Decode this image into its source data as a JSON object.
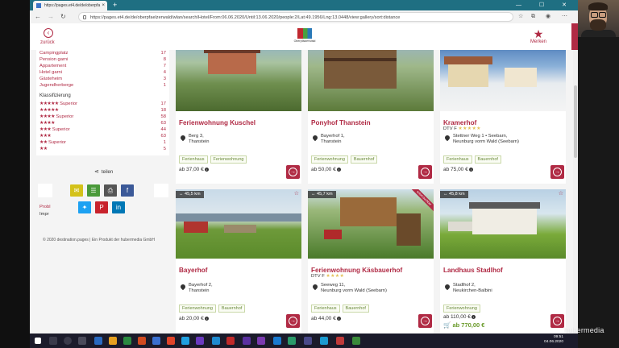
{
  "browser": {
    "tab_title": "https://pages.et4.de/de/oberpfa",
    "tab_close": "×",
    "new_tab": "+",
    "url": "https://pages.et4.de/de/oberpfaelzerwald/wlan/search/Hotel/From:06.06.2020/Until:13.06.2020/people:2/Lat:49.1956/Lng:13.0448/view:gallery/sort:distance",
    "window_controls": "— ☐ ✕"
  },
  "header": {
    "back_label": "zurück",
    "logo_text": "OberpfälzerWald",
    "merken_label": "Merken"
  },
  "filters": {
    "types": [
      {
        "label": "Campingplatz",
        "count": "17"
      },
      {
        "label": "Pension garni",
        "count": "8"
      },
      {
        "label": "Appartement",
        "count": "7"
      },
      {
        "label": "Hotel garni",
        "count": "4"
      },
      {
        "label": "Gästeheim",
        "count": "3"
      },
      {
        "label": "Jugendherberge",
        "count": "1"
      }
    ],
    "classification_heading": "Klassifizierung",
    "classes": [
      {
        "stars": "★★★★★",
        "label": "Superior",
        "count": "17"
      },
      {
        "stars": "★★★★★",
        "label": "",
        "count": "18"
      },
      {
        "stars": "★★★★",
        "label": "Superior",
        "count": "58"
      },
      {
        "stars": "★★★★",
        "label": "",
        "count": "63"
      },
      {
        "stars": "★★★",
        "label": "Superior",
        "count": "44"
      },
      {
        "stars": "★★★",
        "label": "",
        "count": "63"
      },
      {
        "stars": "★★",
        "label": "Superior",
        "count": "1"
      },
      {
        "stars": "★★",
        "label": "",
        "count": "5"
      }
    ]
  },
  "share": {
    "label": "teilen",
    "problem_label": "Probl",
    "impressum_label": "Impr",
    "copyright": "© 2020 destination.pages | Ein Produkt der hubermedia GmbH"
  },
  "cards": [
    {
      "title": "Ferienwohnung Kuschel",
      "dtv": "",
      "address1": "Berg 3,",
      "address2": "Thanstein",
      "tags": [
        "Ferienhaus",
        "Ferienwohnung"
      ],
      "price": "ab 37,00 €",
      "distance": "",
      "highlight": ""
    },
    {
      "title": "Ponyhof Thanstein",
      "dtv": "",
      "address1": "Bayerhof 1,",
      "address2": "Thanstein",
      "tags": [
        "Ferienwohnung",
        "Bauernhof"
      ],
      "price": "ab 50,00 €",
      "distance": "",
      "highlight": ""
    },
    {
      "title": "Kramerhof",
      "dtv": "DTV F",
      "address1": "Stettner Weg 1 • Seebarn,",
      "address2": "Neunburg vorm Wald (Seebarn)",
      "tags": [
        "Ferienhaus",
        "Bauernhof"
      ],
      "price": "ab 75,00 €",
      "distance": "",
      "highlight": ""
    },
    {
      "title": "Bayerhof",
      "dtv": "",
      "address1": "Bayerhof 2,",
      "address2": "Thanstein",
      "tags": [
        "Ferienwohnung",
        "Bauernhof"
      ],
      "price": "ab 20,00 €",
      "distance": "45,5 km",
      "highlight": ""
    },
    {
      "title": "Ferienwohnung Käsbauerhof",
      "dtv": "DTV F",
      "address1": "Seeweg 11,",
      "address2": "Neunburg vorm Wald (Seebarn)",
      "tags": [
        "Ferienhaus",
        "Bauernhof"
      ],
      "price": "ab 44,00 €",
      "distance": "45,7 km",
      "highlight": "",
      "ribbon": "sofort buchbar"
    },
    {
      "title": "Landhaus Stadlhof",
      "dtv": "",
      "address1": "Stadlhof 2,",
      "address2": "Neukirchen-Balbini",
      "tags": [
        "Ferienwohnung"
      ],
      "price": "ab 110,00 €",
      "distance": "45,8 km",
      "highlight": "ab 770,00 €"
    }
  ],
  "taskbar": {
    "time": "09:51",
    "date": "04.06.2020"
  },
  "watermark": "hubermedia"
}
